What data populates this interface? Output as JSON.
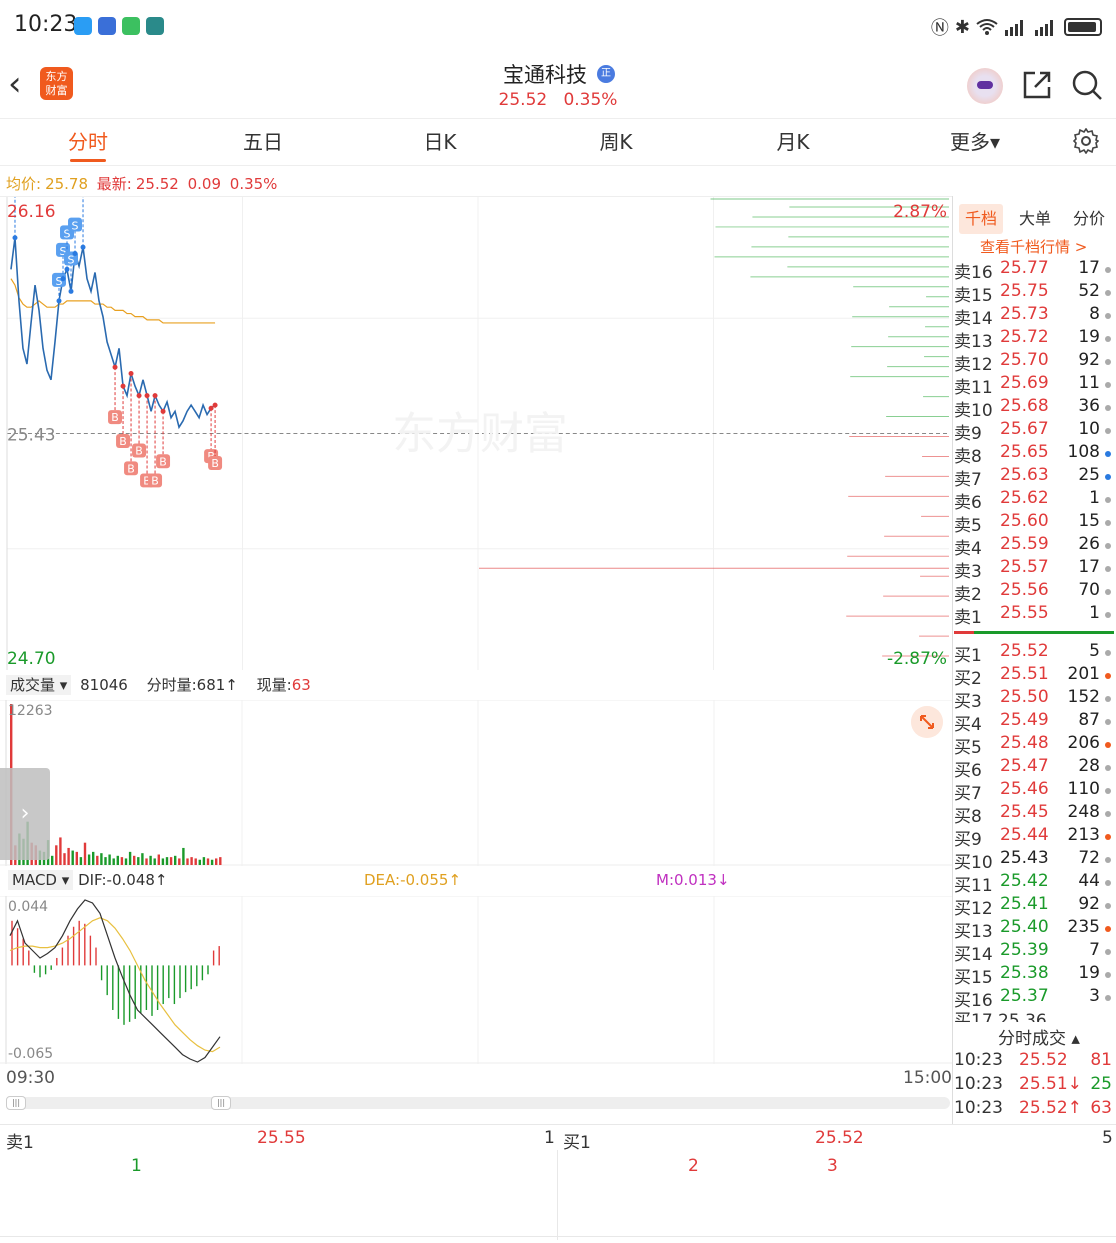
{
  "status_bar": {
    "time": "10:23",
    "notification_icons": [
      "message-icon",
      "browser-icon",
      "app-icon",
      "weather-icon"
    ],
    "system_icons": [
      "nfc-icon",
      "bluetooth-icon",
      "wifi-icon",
      "signal-icon",
      "battery-icon"
    ]
  },
  "header": {
    "logo_line1": "东方",
    "logo_line2": "财富",
    "stock_name": "宝通科技",
    "badge": "正",
    "price": "25.52",
    "change_pct": "0.35%"
  },
  "tabs": [
    {
      "label": "分时",
      "active": true
    },
    {
      "label": "五日",
      "active": false
    },
    {
      "label": "日K",
      "active": false
    },
    {
      "label": "周K",
      "active": false
    },
    {
      "label": "月K",
      "active": false
    },
    {
      "label": "更多▾",
      "active": false
    }
  ],
  "info_line": {
    "avg_label": "均价:",
    "avg_value": "25.78",
    "latest_label": "最新:",
    "latest_value": "25.52",
    "change": "0.09",
    "change_pct": "0.35%"
  },
  "price_chart": {
    "high_label": "26.16",
    "low_label": "24.70",
    "mid_label": "25.43",
    "high_pct": "2.87%",
    "low_pct": "-2.87%",
    "watermark": "东方财富",
    "series": [
      25.95,
      26.05,
      25.85,
      25.7,
      25.65,
      25.78,
      25.9,
      25.82,
      25.7,
      25.63,
      25.6,
      25.72,
      25.85,
      25.92,
      25.95,
      25.88,
      26.0,
      25.96,
      26.02,
      25.92,
      25.88,
      25.94,
      25.85,
      25.8,
      25.72,
      25.68,
      25.64,
      25.7,
      25.58,
      25.55,
      25.62,
      25.58,
      25.55,
      25.6,
      25.55,
      25.5,
      25.55,
      25.52,
      25.5,
      25.53,
      25.48,
      25.5,
      25.45,
      25.47,
      25.5,
      25.52,
      25.5,
      25.48,
      25.52,
      25.49,
      25.51,
      25.52
    ],
    "avg_series": [
      25.92,
      25.9,
      25.86,
      25.84,
      25.83,
      25.83,
      25.84,
      25.85,
      25.84,
      25.83,
      25.83,
      25.83,
      25.84,
      25.84,
      25.85,
      25.85,
      25.85,
      25.85,
      25.85,
      25.85,
      25.85,
      25.84,
      25.84,
      25.84,
      25.83,
      25.83,
      25.82,
      25.82,
      25.82,
      25.81,
      25.81,
      25.8,
      25.8,
      25.8,
      25.79,
      25.79,
      25.79,
      25.79,
      25.78,
      25.78,
      25.78,
      25.78,
      25.78,
      25.78,
      25.78,
      25.78,
      25.78,
      25.78,
      25.78,
      25.78,
      25.78,
      25.78
    ],
    "sell_marks": [
      "S",
      "S",
      "S",
      "S",
      "S",
      "S",
      "S"
    ],
    "buy_marks": [
      "B",
      "B",
      "B",
      "B",
      "B",
      "B",
      "B",
      "B",
      "B"
    ]
  },
  "volume": {
    "label": "成交量",
    "total": "81046",
    "tick_label": "分时量:681",
    "now_label": "现量:",
    "now_value": "63",
    "max_label": "12263",
    "bars": [
      12263,
      1500,
      2400,
      2000,
      3300,
      1700,
      1500,
      1100,
      1000,
      1900,
      700,
      1500,
      2100,
      900,
      1300,
      1100,
      1000,
      600,
      1700,
      800,
      1000,
      700,
      900,
      600,
      800,
      500,
      700,
      600,
      500,
      1000,
      700,
      600,
      900,
      500,
      700,
      500,
      800,
      500,
      600,
      600,
      700,
      500,
      1300,
      500,
      600,
      500,
      400,
      600,
      500,
      400,
      500,
      600
    ]
  },
  "macd": {
    "label": "MACD",
    "dif_label": "DIF:-0.048",
    "dea_label": "DEA:-0.055",
    "m_label": "M:0.013",
    "top_label": "0.044",
    "bottom_label": "-0.065",
    "bars": [
      0.03,
      0.025,
      0.018,
      0.01,
      -0.005,
      -0.008,
      -0.006,
      -0.003,
      0.005,
      0.012,
      0.02,
      0.026,
      0.03,
      0.028,
      0.02,
      0.012,
      -0.01,
      -0.02,
      -0.03,
      -0.036,
      -0.04,
      -0.038,
      -0.036,
      -0.032,
      -0.03,
      -0.034,
      -0.03,
      -0.026,
      -0.022,
      -0.026,
      -0.022,
      -0.018,
      -0.016,
      -0.014,
      -0.01,
      -0.006,
      0.01,
      0.013
    ],
    "dif": [
      0.02,
      0.03,
      0.015,
      0.01,
      0.005,
      0.008,
      0.012,
      0.02,
      0.03,
      0.038,
      0.044,
      0.042,
      0.035,
      0.02,
      0.005,
      -0.008,
      -0.02,
      -0.03,
      -0.035,
      -0.04,
      -0.045,
      -0.05,
      -0.055,
      -0.06,
      -0.063,
      -0.065,
      -0.062,
      -0.055,
      -0.048
    ],
    "dea": [
      0.01,
      0.012,
      0.013,
      0.013,
      0.012,
      0.012,
      0.013,
      0.015,
      0.018,
      0.022,
      0.026,
      0.03,
      0.032,
      0.03,
      0.025,
      0.018,
      0.01,
      0.0,
      -0.01,
      -0.018,
      -0.026,
      -0.033,
      -0.04,
      -0.045,
      -0.05,
      -0.054,
      -0.057,
      -0.058,
      -0.055
    ]
  },
  "time_axis": {
    "start": "09:30",
    "end": "15:00"
  },
  "right_panel": {
    "tabs": [
      "千档",
      "大单",
      "分价"
    ],
    "link": "查看千档行情 >",
    "sells": [
      {
        "label": "卖16",
        "price": "25.77",
        "vol": "17",
        "color": "red",
        "dot": "gray"
      },
      {
        "label": "卖15",
        "price": "25.75",
        "vol": "52",
        "color": "red",
        "dot": "gray"
      },
      {
        "label": "卖14",
        "price": "25.73",
        "vol": "8",
        "color": "red",
        "dot": "gray"
      },
      {
        "label": "卖13",
        "price": "25.72",
        "vol": "19",
        "color": "red",
        "dot": "gray"
      },
      {
        "label": "卖12",
        "price": "25.70",
        "vol": "92",
        "color": "red",
        "dot": "gray"
      },
      {
        "label": "卖11",
        "price": "25.69",
        "vol": "11",
        "color": "red",
        "dot": "gray"
      },
      {
        "label": "卖10",
        "price": "25.68",
        "vol": "36",
        "color": "red",
        "dot": "gray"
      },
      {
        "label": "卖9",
        "price": "25.67",
        "vol": "10",
        "color": "red",
        "dot": "gray"
      },
      {
        "label": "卖8",
        "price": "25.65",
        "vol": "108",
        "color": "red",
        "dot": "blue"
      },
      {
        "label": "卖7",
        "price": "25.63",
        "vol": "25",
        "color": "red",
        "dot": "blue"
      },
      {
        "label": "卖6",
        "price": "25.62",
        "vol": "1",
        "color": "red",
        "dot": "gray"
      },
      {
        "label": "卖5",
        "price": "25.60",
        "vol": "15",
        "color": "red",
        "dot": "gray"
      },
      {
        "label": "卖4",
        "price": "25.59",
        "vol": "26",
        "color": "red",
        "dot": "gray"
      },
      {
        "label": "卖3",
        "price": "25.57",
        "vol": "17",
        "color": "red",
        "dot": "gray"
      },
      {
        "label": "卖2",
        "price": "25.56",
        "vol": "70",
        "color": "red",
        "dot": "gray"
      },
      {
        "label": "卖1",
        "price": "25.55",
        "vol": "1",
        "color": "red",
        "dot": "gray"
      }
    ],
    "buys": [
      {
        "label": "买1",
        "price": "25.52",
        "vol": "5",
        "color": "red",
        "dot": "gray"
      },
      {
        "label": "买2",
        "price": "25.51",
        "vol": "201",
        "color": "red",
        "dot": "orange"
      },
      {
        "label": "买3",
        "price": "25.50",
        "vol": "152",
        "color": "red",
        "dot": "gray"
      },
      {
        "label": "买4",
        "price": "25.49",
        "vol": "87",
        "color": "red",
        "dot": "gray"
      },
      {
        "label": "买5",
        "price": "25.48",
        "vol": "206",
        "color": "red",
        "dot": "orange"
      },
      {
        "label": "买6",
        "price": "25.47",
        "vol": "28",
        "color": "red",
        "dot": "gray"
      },
      {
        "label": "买7",
        "price": "25.46",
        "vol": "110",
        "color": "red",
        "dot": "gray"
      },
      {
        "label": "买8",
        "price": "25.45",
        "vol": "248",
        "color": "red",
        "dot": "gray"
      },
      {
        "label": "买9",
        "price": "25.44",
        "vol": "213",
        "color": "red",
        "dot": "orange"
      },
      {
        "label": "买10",
        "price": "25.43",
        "vol": "72",
        "color": "black",
        "dot": "gray"
      },
      {
        "label": "买11",
        "price": "25.42",
        "vol": "44",
        "color": "green",
        "dot": "gray"
      },
      {
        "label": "买12",
        "price": "25.41",
        "vol": "92",
        "color": "green",
        "dot": "gray"
      },
      {
        "label": "买13",
        "price": "25.40",
        "vol": "235",
        "color": "green",
        "dot": "orange"
      },
      {
        "label": "买14",
        "price": "25.39",
        "vol": "7",
        "color": "green",
        "dot": "gray"
      },
      {
        "label": "买15",
        "price": "25.38",
        "vol": "19",
        "color": "green",
        "dot": "gray"
      },
      {
        "label": "买16",
        "price": "25.37",
        "vol": "3",
        "color": "green",
        "dot": "gray"
      }
    ],
    "ticks_title": "分时成交",
    "ticks": [
      {
        "time": "10:23",
        "price": "25.52",
        "vol": "81",
        "arrow": ""
      },
      {
        "time": "10:23",
        "price": "25.51↓",
        "vol": "25",
        "arrow": "down"
      },
      {
        "time": "10:23",
        "price": "25.52↑",
        "vol": "63",
        "arrow": "up"
      }
    ]
  },
  "bottom": {
    "sell_label": "卖1",
    "sell_price": "25.55",
    "sell_vol": "1",
    "buy_label": "买1",
    "buy_price": "25.52",
    "buy_vol": "5",
    "sell_detail": [
      "1"
    ],
    "buy_detail": [
      "2",
      "3"
    ]
  },
  "colors": {
    "up": "#e03a3a",
    "down": "#1a9a2a",
    "accent": "#f05a1e",
    "avg": "#e8a020",
    "line": "#2a6ab0"
  }
}
